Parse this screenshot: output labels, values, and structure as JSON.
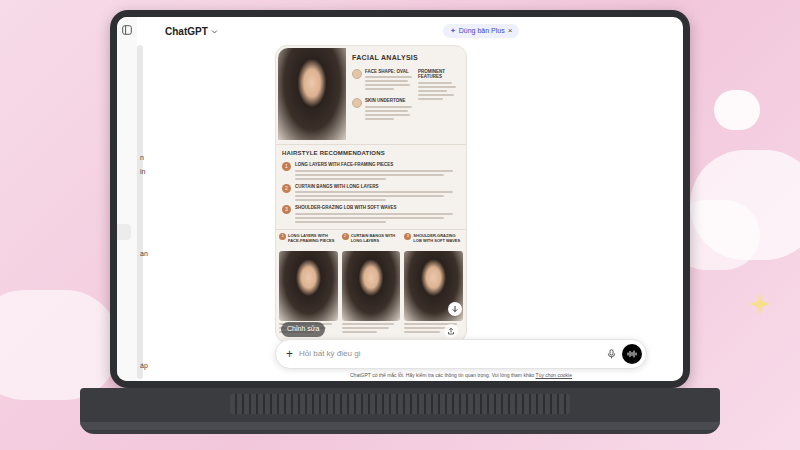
{
  "sidebar": {
    "items": [
      "n",
      "in",
      "an",
      "áp"
    ]
  },
  "header": {
    "title": "ChatGPT"
  },
  "plus_badge": {
    "icon": "✦",
    "label": "Dùng bản Plus",
    "close": "×"
  },
  "image_card": {
    "title": "FACIAL ANALYSIS",
    "details": [
      {
        "title": "FACE SHAPE: OVAL"
      },
      {
        "title": "SKIN UNDERTONE"
      }
    ],
    "features": {
      "title": "PROMINENT FEATURES"
    },
    "recommendations": {
      "title": "HAIRSTYLE RECOMMENDATIONS",
      "items": [
        {
          "number": "1",
          "title": "LONG LAYERS WITH FACE-FRAMING PIECES"
        },
        {
          "number": "2",
          "title": "CURTAIN BANGS WITH LONG LAYERS"
        },
        {
          "number": "3",
          "title": "SHOULDER-GRAZING LOB WITH SOFT WAVES"
        }
      ]
    },
    "previews": [
      {
        "number": "1",
        "title": "LONG LAYERS WITH FACE-FRAMING PIECES"
      },
      {
        "number": "2",
        "title": "CURTAIN BANGS WITH LONG LAYERS"
      },
      {
        "number": "3",
        "title": "SHOULDER-GRAZING LOB WITH SOFT WAVES"
      }
    ],
    "edit_button": "Chỉnh sửa"
  },
  "composer": {
    "plus": "+",
    "placeholder": "Hỏi bất kỳ điều gì"
  },
  "disclaimer": {
    "text": "ChatGPT có thể mắc lỗi. Hãy kiểm tra các thông tin quan trọng. Vui lòng tham khảo",
    "link": "Tùy chọn cookie"
  }
}
